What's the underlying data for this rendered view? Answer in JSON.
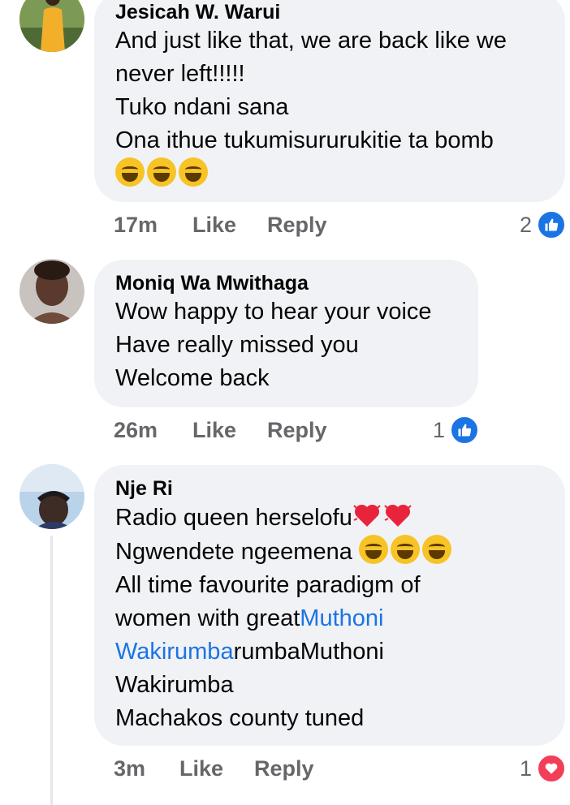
{
  "comments": [
    {
      "author": "Jesicah W. Warui",
      "lines": [
        "And just like that, we are back like we",
        "never left!!!!!",
        "Tuko ndani sana",
        "Ona ithue tukumisururukitie ta bomb"
      ],
      "emoji_line": [
        "laughing-tears-emoji",
        "laughing-tears-emoji",
        "laughing-tears-emoji"
      ],
      "time": "17m",
      "like_label": "Like",
      "reply_label": "Reply",
      "reaction_count": "2",
      "reaction_type": "like"
    },
    {
      "author": "Moniq Wa Mwithaga",
      "lines": [
        "Wow happy to hear your voice",
        "Have really missed you",
        "Welcome back"
      ],
      "time": "26m",
      "like_label": "Like",
      "reply_label": "Reply",
      "reaction_count": "1",
      "reaction_type": "like"
    },
    {
      "author": "Nje Ri",
      "line1": "Radio queen herselofu",
      "line2": "Ngwendete ngeemena",
      "line3": "All time favourite paradigm of",
      "line4_text": "women with great",
      "mention_a": "Muthoni",
      "mention_b": "Wakirumba",
      "line5_tail": "rumbaMuthoni",
      "line6": "Wakirumba",
      "line7": "Machakos county tuned",
      "time": "3m",
      "like_label": "Like",
      "reply_label": "Reply",
      "reaction_count": "1",
      "reaction_type": "love"
    }
  ],
  "colors": {
    "bubble": "#f0f2f5",
    "meta": "#65676b",
    "mention": "#1b74e4",
    "like": "#1b74e4",
    "love": "#f33e58"
  }
}
